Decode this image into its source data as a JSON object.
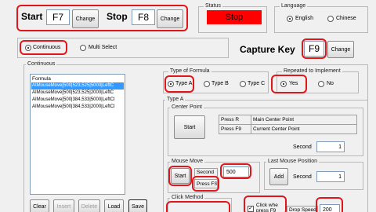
{
  "top": {
    "start_label": "Start",
    "start_key": "F7",
    "start_change": "Change",
    "stop_label": "Stop",
    "stop_key": "F8",
    "stop_change": "Change"
  },
  "status": {
    "title": "Status",
    "value": "Stop",
    "color": "#ff0000"
  },
  "language": {
    "title": "Language",
    "options": [
      "English",
      "Chinese"
    ],
    "selected": "English"
  },
  "mode": {
    "options": [
      "Continuous",
      "Multi Select"
    ],
    "selected": "Continuous"
  },
  "capture": {
    "label": "Capture Key",
    "key": "F9",
    "change": "Change"
  },
  "continuous": {
    "title": "Continuous",
    "list_header": "Formula",
    "list_items": [
      "AIMouseMove[500|523,525|5000|LeftC",
      "AIMouseMove[500|523,525|2000|LeftC",
      "AIMouseMove[500|384,533|5000|LeftCl",
      "AIMouseMove[500|384,533|2000|LeftCl"
    ],
    "selected_index": 0,
    "buttons": [
      "Clear",
      "Insert",
      "Delete",
      "Load",
      "Save"
    ],
    "disabled_buttons": [
      "Insert",
      "Delete"
    ]
  },
  "type_of_formula": {
    "title": "Type of Formula",
    "options": [
      "Type A",
      "Type B",
      "Type C"
    ],
    "selected": "Type A"
  },
  "repeated": {
    "title": "Repeated to Implement",
    "options": [
      "Yes",
      "No"
    ],
    "selected": "Yes"
  },
  "type_a": {
    "title": "Type A",
    "center_point": {
      "title": "Center Point",
      "start": "Start",
      "press_r": "Press R",
      "main_center": "Main Center Point",
      "press_f9": "Press F9",
      "current_center": "Current Center Point",
      "second_label": "Second",
      "second_value": "1"
    },
    "mouse_move": {
      "title": "Mouse Move",
      "start": "Start",
      "second_label": "Second",
      "second_value": "500",
      "press_fs": "Press FS"
    },
    "last_mouse": {
      "title": "Last Mouse Position",
      "add": "Add",
      "second_label": "Second",
      "second_value": "1"
    },
    "click_method": {
      "title": "Click Method"
    },
    "click_when": "Click whe press F9",
    "drop_speed_label": "Drop Speed",
    "drop_speed_value": "200"
  }
}
